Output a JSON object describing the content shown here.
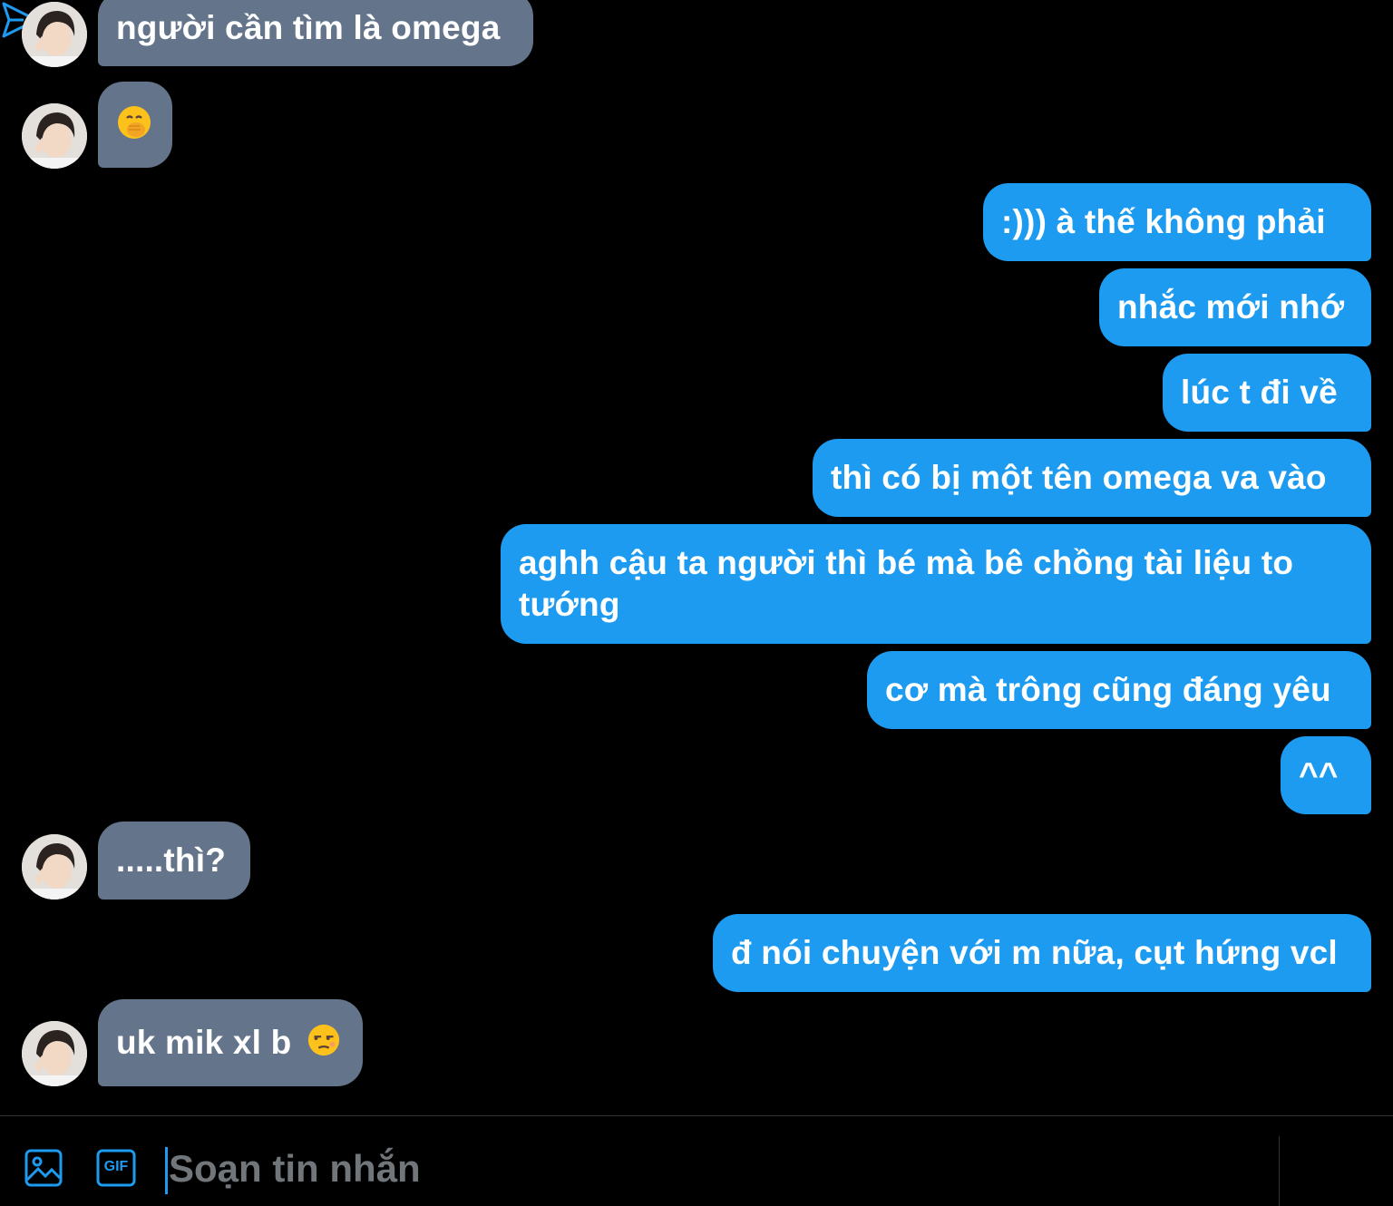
{
  "messages": [
    {
      "side": "in",
      "text": "người cần tìm là omega"
    },
    {
      "side": "in",
      "text": "",
      "emoji": "face-with-hand-over-mouth-emoji"
    },
    {
      "side": "out",
      "text": ":))) à thế không phải"
    },
    {
      "side": "out",
      "text": "nhắc mới nhớ"
    },
    {
      "side": "out",
      "text": "lúc t đi về"
    },
    {
      "side": "out",
      "text": "thì có bị một tên omega va vào"
    },
    {
      "side": "out",
      "text": "aghh cậu ta người thì bé mà bê chồng tài liệu to tướng"
    },
    {
      "side": "out",
      "text": "cơ mà trông cũng đáng yêu"
    },
    {
      "side": "out",
      "text": "^^"
    },
    {
      "side": "in",
      "text": ".....thì?"
    },
    {
      "side": "out",
      "text": "đ nói chuyện với m nữa, cụt hứng vcl"
    },
    {
      "side": "in",
      "text": "uk mik xl b",
      "emoji": "unamused-face-emoji"
    }
  ],
  "composer": {
    "placeholder": "Soạn tin nhắn",
    "gif_label": "GIF",
    "image_icon": "image-icon",
    "gif_icon": "gif-icon",
    "send_icon": "send-icon"
  },
  "colors": {
    "background": "#000000",
    "incoming_bubble": "#64748a",
    "outgoing_bubble": "#1d9bf0",
    "accent": "#1d9bf0",
    "placeholder": "#71767b",
    "divider": "#2f3336"
  }
}
